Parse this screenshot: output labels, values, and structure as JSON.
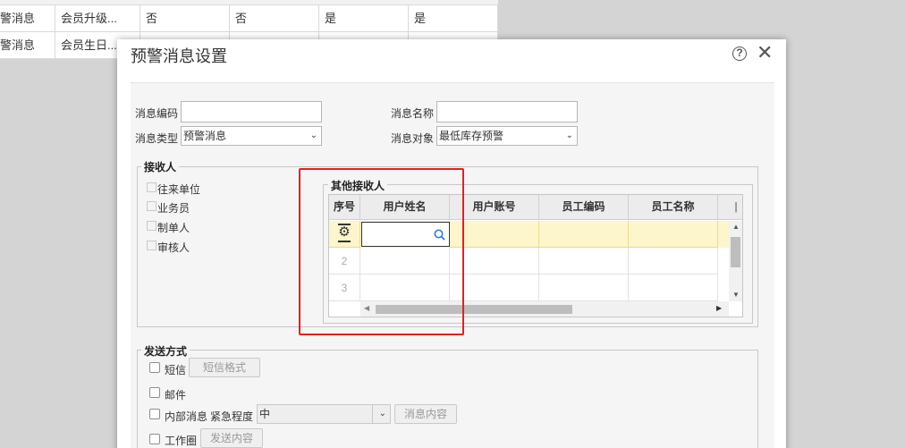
{
  "background_table": {
    "rows": [
      [
        "警消息",
        "会员升级...",
        "否",
        "否",
        "是",
        "是"
      ],
      [
        "警消息",
        "会员生日..."
      ]
    ]
  },
  "dialog": {
    "title": "预警消息设置",
    "help_icon": "question-circle-icon",
    "help_glyph": "?",
    "close_icon": "close-icon",
    "close_glyph": "✕"
  },
  "form": {
    "code_label": "消息编码",
    "code_value": "",
    "name_label": "消息名称",
    "name_value": "",
    "type_label": "消息类型",
    "type_value": "预警消息",
    "target_label": "消息对象",
    "target_value": "最低库存预警"
  },
  "receivers": {
    "legend": "接收人",
    "options": [
      "往来单位",
      "业务员",
      "制单人",
      "审核人"
    ]
  },
  "other_receivers": {
    "legend": "其他接收人",
    "columns": [
      "序号",
      "用户姓名",
      "用户账号",
      "员工编码",
      "员工名称"
    ],
    "rows": [
      "",
      "2",
      "3"
    ],
    "settings_icon": "gear-icon",
    "settings_glyph": "⚙",
    "search_icon": "search-icon"
  },
  "send_method": {
    "legend": "发送方式",
    "sms_label": "短信",
    "sms_format_button": "短信格式",
    "email_label": "邮件",
    "internal_label": "内部消息",
    "urgency_label": "紧急程度",
    "urgency_value": "中",
    "message_content_button": "消息内容",
    "workcircle_label": "工作圈",
    "send_content_button": "发送内容"
  },
  "colors": {
    "highlight": "#e5201e",
    "selected_row": "#fdf5cc"
  }
}
